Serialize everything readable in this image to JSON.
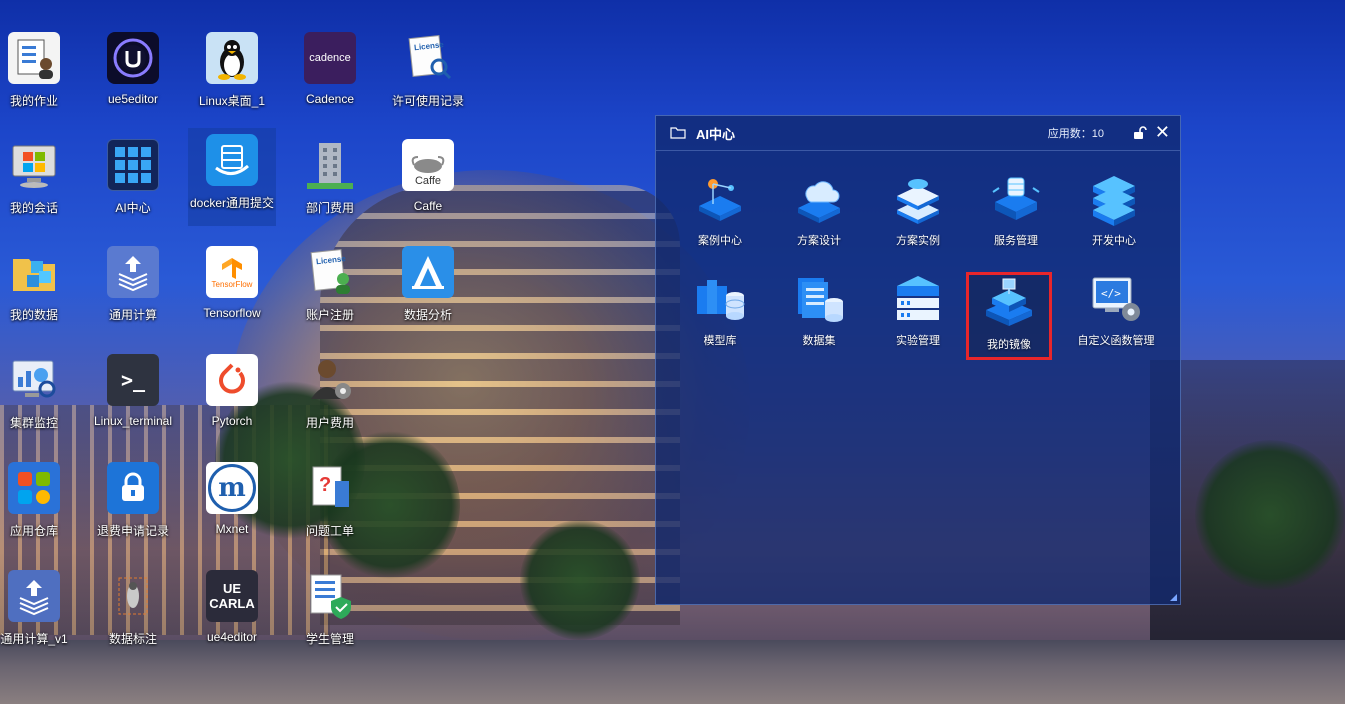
{
  "desktop": {
    "icons": [
      {
        "label": "我的作业",
        "icon": "clipboard-user-icon"
      },
      {
        "label": "ue5editor",
        "icon": "unreal-engine-icon"
      },
      {
        "label": "Linux桌面_1",
        "icon": "linux-penguin-icon"
      },
      {
        "label": "Cadence",
        "icon": "cadence-icon",
        "text": "cadence"
      },
      {
        "label": "许可使用记录",
        "icon": "license-search-icon",
        "text": "License"
      },
      {
        "label": "我的会话",
        "icon": "monitor-windows-icon"
      },
      {
        "label": "AI中心",
        "icon": "app-grid-icon"
      },
      {
        "label": "docker通用提交",
        "icon": "docker-icon"
      },
      {
        "label": "部门费用",
        "icon": "building-icon"
      },
      {
        "label": "Caffe",
        "icon": "caffe-icon",
        "text": "Caffe"
      },
      {
        "label": "我的数据",
        "icon": "folder-cubes-icon"
      },
      {
        "label": "通用计算",
        "icon": "upload-layers-icon"
      },
      {
        "label": "Tensorflow",
        "icon": "tensorflow-icon",
        "text": "TensorFlow"
      },
      {
        "label": "账户注册",
        "icon": "license-user-icon",
        "text": "License"
      },
      {
        "label": "数据分析",
        "icon": "analysis-icon"
      },
      {
        "label": "集群监控",
        "icon": "monitor-chart-icon"
      },
      {
        "label": "Linux_terminal",
        "icon": "terminal-icon",
        "text": ">_"
      },
      {
        "label": "Pytorch",
        "icon": "pytorch-icon"
      },
      {
        "label": "用户费用",
        "icon": "user-gear-icon"
      },
      {
        "label": "应用仓库",
        "icon": "app-store-icon"
      },
      {
        "label": "退费申请记录",
        "icon": "lock-icon"
      },
      {
        "label": "Mxnet",
        "icon": "mxnet-icon",
        "text": "m"
      },
      {
        "label": "问题工单",
        "icon": "question-doc-icon"
      },
      {
        "label": "通用计算_v1",
        "icon": "upload-layers-icon"
      },
      {
        "label": "数据标注",
        "icon": "annotation-icon"
      },
      {
        "label": "ue4editor",
        "icon": "carla-icon",
        "text": "UE CARLA"
      },
      {
        "label": "学生管理",
        "icon": "student-shield-icon"
      }
    ]
  },
  "window": {
    "title": "AI中心",
    "count_label": "应用数：",
    "count_value": "10",
    "close": "✕",
    "apps": [
      {
        "label": "案例中心",
        "icon": "case-center-icon"
      },
      {
        "label": "方案设计",
        "icon": "cloud-design-icon"
      },
      {
        "label": "方案实例",
        "icon": "gear-instance-icon"
      },
      {
        "label": "服务管理",
        "icon": "service-cube-icon"
      },
      {
        "label": "开发中心",
        "icon": "server-stack-icon"
      },
      {
        "label": "模型库",
        "icon": "model-library-icon"
      },
      {
        "label": "数据集",
        "icon": "dataset-icon"
      },
      {
        "label": "实验管理",
        "icon": "experiment-icon"
      },
      {
        "label": "我的镜像",
        "icon": "image-cube-icon",
        "highlight": true
      },
      {
        "label": "自定义函数管理",
        "icon": "code-gear-icon"
      }
    ]
  },
  "colors": {
    "accent": "#1a7cf0",
    "highlight": "#e8262b",
    "window_bg": "#10286e"
  }
}
